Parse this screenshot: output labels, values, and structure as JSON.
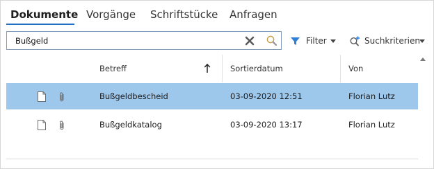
{
  "tabs": [
    {
      "label": "Dokumente",
      "active": true
    },
    {
      "label": "Vorgänge",
      "active": false
    },
    {
      "label": "Schriftstücke",
      "active": false
    },
    {
      "label": "Anfragen",
      "active": false
    }
  ],
  "search": {
    "value": "Bußgeld",
    "clear_icon": "close-x-icon",
    "search_icon": "magnifier-icon"
  },
  "toolbar": {
    "filter_label": "Filter",
    "criteria_label": "Suchkriterien"
  },
  "table": {
    "columns": [
      "Betreff",
      "Sortierdatum",
      "Von"
    ],
    "sort_column": "Betreff",
    "sort_direction": "ascending",
    "rows": [
      {
        "betreff": "Bußgeldbescheid",
        "datum": "03-09-2020 12:51",
        "von": "Florian Lutz",
        "selected": true
      },
      {
        "betreff": "Bußgeldkatalog",
        "datum": "03-09-2020 13:17",
        "von": "Florian Lutz",
        "selected": false
      }
    ]
  },
  "colors": {
    "accent": "#1e6fc4",
    "selected_row": "#9ec7ec",
    "filter_icon": "#2f7fd4"
  }
}
